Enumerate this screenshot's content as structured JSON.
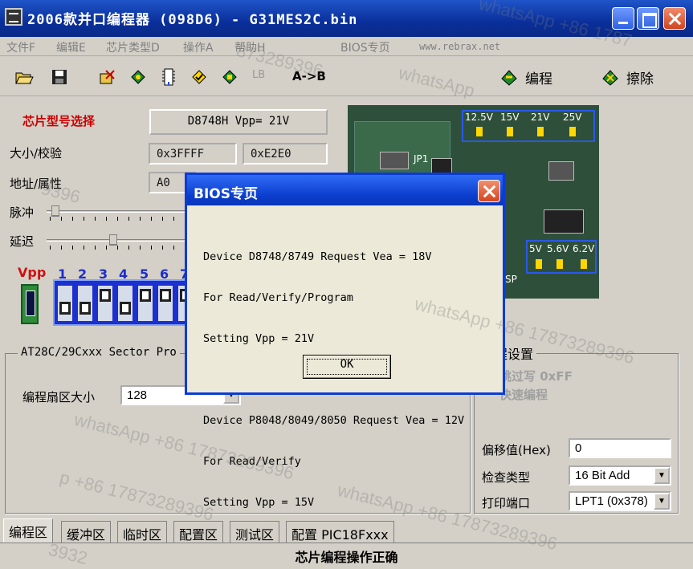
{
  "window": {
    "title": "2006款并口编程器 (098D6) - G31MES2C.bin"
  },
  "menu": {
    "items": [
      "文件F",
      "编辑E",
      "芯片类型D",
      "操作A",
      "帮助H",
      "BIOS专页"
    ],
    "url": "www.rebrax.net"
  },
  "toolbar": {
    "lb": "LB",
    "a_to_b": "A->B",
    "program": "编程",
    "erase": "擦除"
  },
  "chip": {
    "select_label": "芯片型号选择",
    "chip_button": "D8748H  Vpp= 21V",
    "size_label": "大小/校验",
    "size_value": "0x3FFFF",
    "checksum_value": "0xE2E0",
    "addr_label": "地址/属性",
    "addr_value": "A0",
    "pulse_label": "脉冲",
    "delay_label": "延迟",
    "vpp_label": "Vpp",
    "vpp_numbers": [
      "1",
      "2",
      "3",
      "4",
      "5",
      "6",
      "7"
    ]
  },
  "board": {
    "voltages_top": [
      "12.5V",
      "15V",
      "21V",
      "25V"
    ],
    "voltages_bottom": [
      "5V",
      "5.6V",
      "6.2V"
    ],
    "jp1": "JP1",
    "sp": "SP"
  },
  "sector": {
    "title": "AT28C/29Cxxx Sector Pro",
    "size_label": "编程扇区大小",
    "size_value": "128"
  },
  "settings": {
    "title": "程设置",
    "skip": "跳过写 0xFF",
    "fast": "快速编程",
    "offset_label": "偏移值(Hex)",
    "offset_value": "0",
    "check_label": "检查类型",
    "check_value": "16 Bit Add",
    "port_label": "打印端口",
    "port_value": "LPT1 (0x378)"
  },
  "tabs": [
    "编程区",
    "缓冲区",
    "临时区",
    "配置区",
    "测试区",
    "配置 PIC18Fxxx"
  ],
  "status": "芯片编程操作正确",
  "dialog": {
    "title": "BIOS专页",
    "lines": [
      "Device D8748/8749 Request Vea = 18V",
      "For Read/Verify/Program",
      "Setting Vpp = 21V",
      "",
      "Device P8048/8049/8050 Request Vea = 12V",
      "For Read/Verify",
      "Setting Vpp = 15V"
    ],
    "ok_label": "OK"
  },
  "watermark": {
    "text_full": "whatsApp +86 17873289396",
    "fragments": [
      "9396",
      "whatsApp +86 1787",
      "whatsApp",
      "p +86 17873289396",
      "873289396",
      "+86 17873289396",
      "whatsApp +86 17873289396",
      "3932"
    ]
  }
}
